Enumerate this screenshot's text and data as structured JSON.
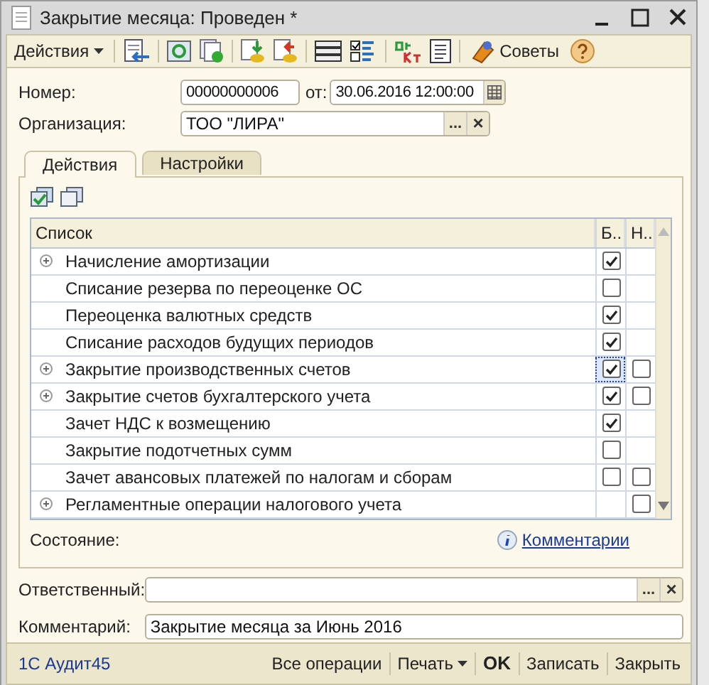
{
  "window": {
    "title": "Закрытие месяца: Проведен *"
  },
  "toolbar": {
    "actions_menu": "Действия",
    "tips": "Советы"
  },
  "fields": {
    "number_label": "Номер:",
    "number": "00000000006",
    "date_label": "от:",
    "date": "30.06.2016 12:00:00",
    "org_label": "Организация:",
    "org": "ТОО \"ЛИРА\"",
    "org_select": "...",
    "org_clear": "×"
  },
  "tabs": [
    {
      "label": "Действия",
      "selected": true
    },
    {
      "label": "Настройки",
      "selected": false
    }
  ],
  "table": {
    "columns": [
      "Список",
      "Б..",
      "Н.."
    ],
    "rows": [
      {
        "name": "Начисление амортизации",
        "expandable": true,
        "focused": false,
        "b": {
          "checked": true
        }
      },
      {
        "name": "Списание резерва по переоценке ОС",
        "expandable": false,
        "focused": false,
        "b": {
          "checked": false
        }
      },
      {
        "name": "Переоценка валютных средств",
        "expandable": false,
        "focused": false,
        "b": {
          "checked": true
        }
      },
      {
        "name": "Списание расходов будущих периодов",
        "expandable": false,
        "focused": false,
        "b": {
          "checked": true
        }
      },
      {
        "name": "Закрытие производственных счетов",
        "expandable": true,
        "focused": true,
        "b": {
          "checked": true
        },
        "n": {
          "checked": false
        }
      },
      {
        "name": "Закрытие счетов бухгалтерского учета",
        "expandable": true,
        "focused": false,
        "b": {
          "checked": true
        },
        "n": {
          "checked": false
        }
      },
      {
        "name": "Зачет НДС к возмещению",
        "expandable": false,
        "focused": false,
        "b": {
          "checked": true
        }
      },
      {
        "name": "Закрытие подотчетных сумм",
        "expandable": false,
        "focused": false,
        "b": {
          "checked": false
        }
      },
      {
        "name": "Зачет авансовых платежей по налогам и сборам",
        "expandable": false,
        "focused": false,
        "b": {
          "checked": false
        },
        "n": {
          "checked": false
        }
      },
      {
        "name": "Регламентные операции налогового учета",
        "expandable": true,
        "focused": false,
        "n": {
          "checked": false
        }
      }
    ]
  },
  "status_label": "Состояние:",
  "comments_link": "Комментарии",
  "responsible": {
    "label": "Ответственный:",
    "select": "...",
    "clear": "×"
  },
  "comment": {
    "label": "Комментарий:",
    "value": "Закрытие месяца за Июнь 2016"
  },
  "footer": {
    "left": "1С Аудит45",
    "buttons": [
      {
        "label": "Все операции",
        "kind": "plain"
      },
      {
        "label": "Печать",
        "kind": "menu"
      },
      {
        "label": "OK",
        "kind": "default"
      },
      {
        "label": "Записать",
        "kind": "plain"
      },
      {
        "label": "Закрыть",
        "kind": "plain"
      }
    ]
  }
}
